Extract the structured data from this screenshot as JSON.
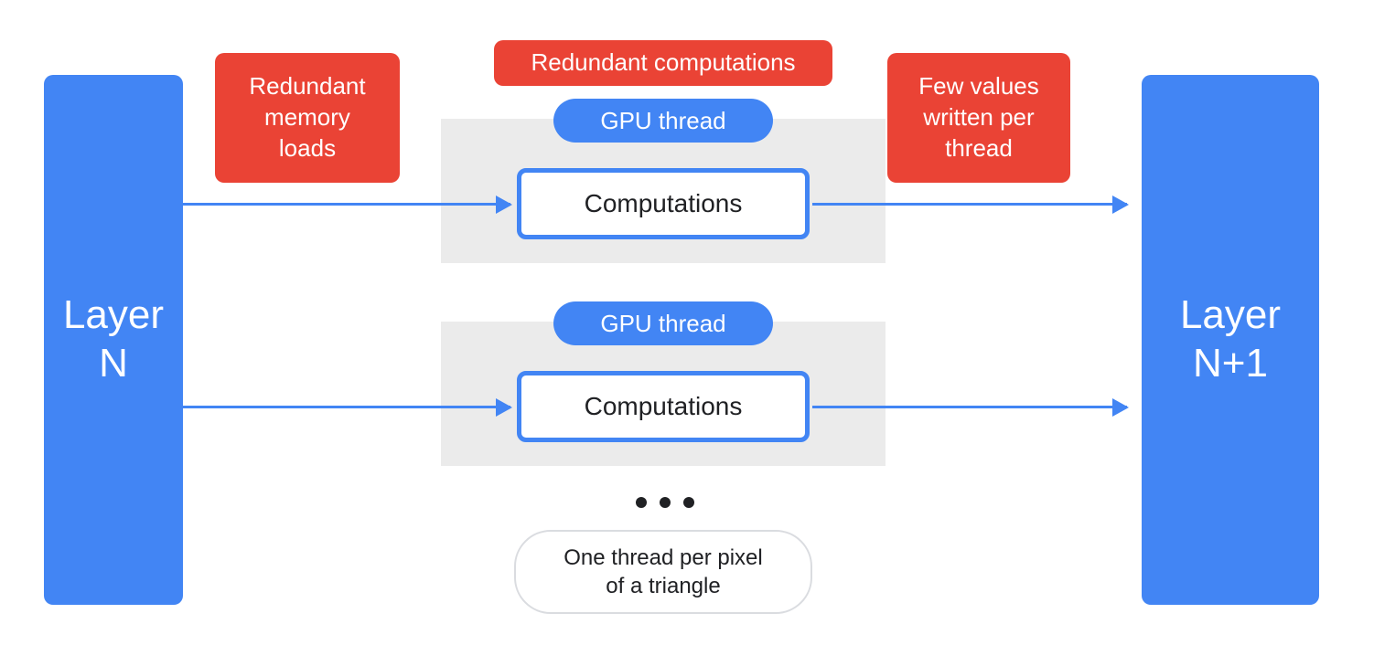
{
  "colors": {
    "blue": "#4285f4",
    "red": "#ea4335",
    "grey": "#ebebeb",
    "text": "#202124"
  },
  "layers": {
    "left": "Layer\nN",
    "right": "Layer\nN+1"
  },
  "problems": {
    "redundant_memory": "Redundant\nmemory\nloads",
    "redundant_computations": "Redundant computations",
    "few_values": "Few values\nwritten per\nthread"
  },
  "threads": {
    "gpu_label": "GPU thread",
    "computation_label": "Computations"
  },
  "caption": "One thread per pixel\nof a triangle"
}
